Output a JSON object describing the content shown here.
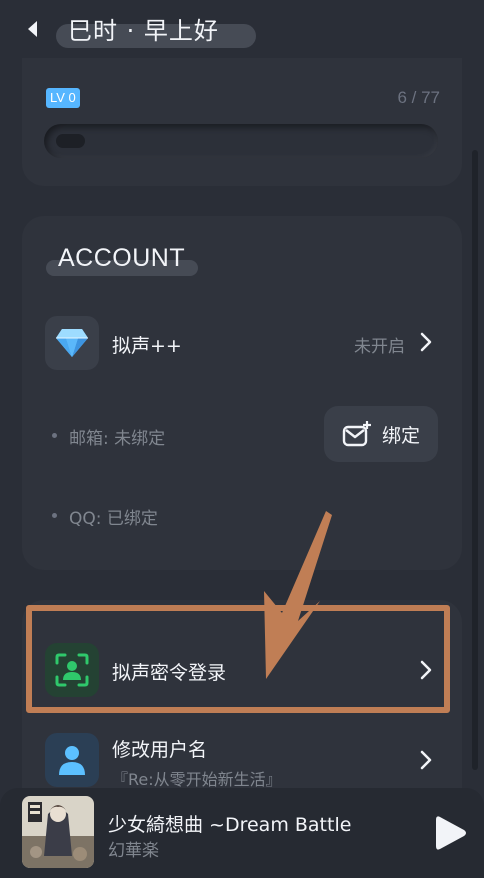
{
  "header": {
    "title": "巳时 · 早上好"
  },
  "level": {
    "badge": "LV 0",
    "progress_text": "6 / 77",
    "progress_fraction": 0.078
  },
  "account": {
    "section_title": "ACCOUNT",
    "plus": {
      "label": "拟声++",
      "status": "未开启"
    },
    "email": {
      "label": "邮箱: 未绑定",
      "button": "绑定"
    },
    "qq": {
      "label": "QQ: 已绑定"
    }
  },
  "list": {
    "password_login": {
      "label": "拟声密令登录"
    },
    "rename": {
      "label": "修改用户名",
      "current": "『Re:从零开始新生活』"
    }
  },
  "player": {
    "title": "少女綺想曲 ~Dream Battle",
    "artist": "幻華楽"
  },
  "colors": {
    "accent_blue": "#56b6ff",
    "green": "#2fc86b",
    "highlight": "#c07e55"
  }
}
